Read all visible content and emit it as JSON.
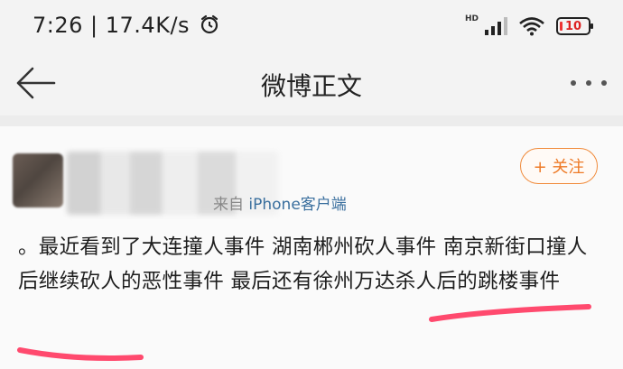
{
  "status_bar": {
    "time": "7:26",
    "speed": "17.4K/s",
    "alarm_icon": "alarm-clock-icon",
    "network_label": "HD",
    "signal_icon": "signal-bars-icon",
    "wifi_icon": "wifi-icon",
    "battery_level": "10"
  },
  "nav": {
    "back_icon": "arrow-left-icon",
    "title": "微博正文",
    "more_icon": "more-dots-icon"
  },
  "post": {
    "source_prefix": "来自 ",
    "source_brand": "iPhone客户端",
    "follow_label": "+ 关注",
    "text": "。最近看到了大连撞人事件 湖南郴州砍人事件 南京新街口撞人后继续砍人的恶性事件 最后还有徐州万达杀人后的跳楼事件",
    "highlight_color": "#ff2a55"
  }
}
